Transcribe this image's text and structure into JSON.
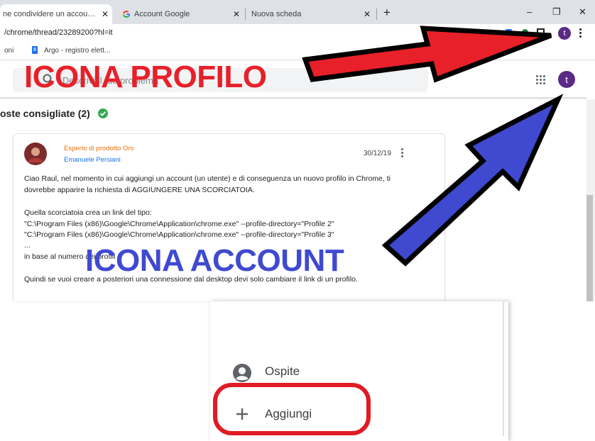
{
  "tabs": [
    {
      "label": "ne condividere un account ch",
      "close": "✕"
    },
    {
      "label": "Account Google",
      "close": "✕"
    },
    {
      "label": "Nuova scheda",
      "close": "✕"
    }
  ],
  "new_tab": "+",
  "window_controls": {
    "minimize": "–",
    "restore": "❐",
    "close": "✕"
  },
  "omnibox": {
    "url": "/chrome/thread/23289200?hl=it"
  },
  "profile_avatar_letter": "t",
  "bookmarks": [
    {
      "label": "oni"
    },
    {
      "label": "Argo - registro elett..."
    }
  ],
  "search": {
    "placeholder": "Descrivi il tuo problema"
  },
  "account_avatar_letter": "t",
  "thread": {
    "section_title": "oste consigliate (2)",
    "badge": "Esperto di prodotto Oro",
    "author": "Emanuele Persiani",
    "date": "30/12/19",
    "body": [
      "Ciao Raul, nel momento in cui aggiungi un account (un utente) e di conseguenza un nuovo profilo in Chrome, ti",
      "dovrebbe apparire la richiesta di AGGIUNGERE UNA SCORCIATOIA.",
      "Quella scorciatoia crea un link del tipo:",
      "\"C:\\Program Files (x86)\\Google\\Chrome\\Application\\chrome.exe\" --profile-directory=\"Profile 2\"",
      "\"C:\\Program Files (x86)\\Google\\Chrome\\Application\\chrome.exe\" --profile-directory=\"Profile 3\"",
      "...",
      "in base al numero dei profili",
      "Quindi se vuoi creare a posteriori una connessione dal desktop devi solo cambiare il link di un profilo."
    ]
  },
  "callouts": {
    "profile": "ICONA PROFILO",
    "account": "ICONA ACCOUNT"
  },
  "colors": {
    "red_arrow": "#e8202a",
    "blue_arrow": "#3f4ad0",
    "callout_red": "#e8202a",
    "callout_blue": "#3f4ad0",
    "badge_orange": "#e8710a",
    "author_blue": "#1a73e8",
    "avatar_purple": "#5b2a86",
    "check_green": "#34a853"
  },
  "inset_menu": [
    {
      "icon": "person-icon",
      "label": "Ospite"
    },
    {
      "icon": "plus-icon",
      "label": "Aggiungi"
    }
  ]
}
